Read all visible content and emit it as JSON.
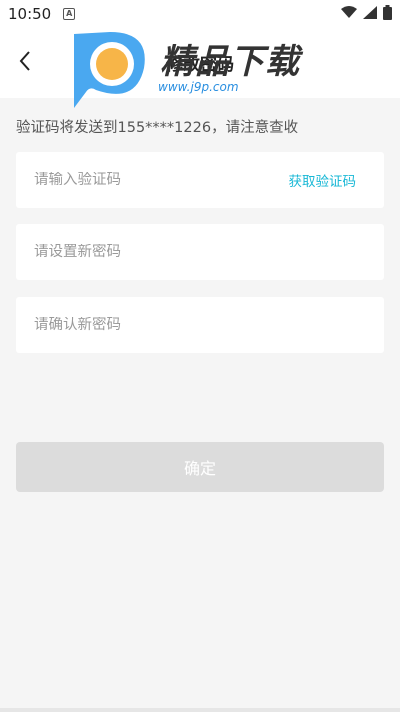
{
  "status_bar": {
    "time": "10:50",
    "notification_icon": "A",
    "icons": [
      "wifi-icon",
      "signal-icon",
      "battery-icon"
    ]
  },
  "header": {
    "title": "修改密码",
    "back_icon": "chevron-left-icon"
  },
  "watermark": {
    "text": "精品下载",
    "url": "www.j9p.com",
    "logo_colors": [
      "#4aa8f0",
      "#f7b548"
    ]
  },
  "notice": "验证码将发送到155****1226，请注意查收",
  "form": {
    "code_placeholder": "请输入验证码",
    "get_code_label": "获取验证码",
    "new_password_placeholder": "请设置新密码",
    "confirm_password_placeholder": "请确认新密码"
  },
  "confirm_button_label": "确定",
  "colors": {
    "accent": "#19b8d6",
    "button_disabled": "#dcdcdc",
    "background": "#f5f5f5"
  }
}
